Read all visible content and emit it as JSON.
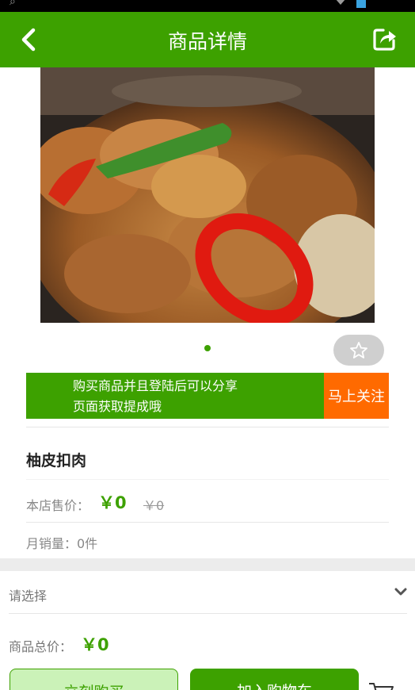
{
  "header": {
    "title": "商品详情"
  },
  "promo": {
    "line1": "购买商品并且登陆后可以分享",
    "line2": "页面获取提成哦",
    "follow_label": "马上关注"
  },
  "product": {
    "name": "柚皮扣肉",
    "price_label": "本店售价：",
    "price": "￥0",
    "original_price": "￥0",
    "monthly_sales": "月销量：0件"
  },
  "order": {
    "select_placeholder": "请选择",
    "total_label": "商品总价：",
    "total": "￥0",
    "buy_now_label": "立刻购买",
    "add_to_cart_label": "加入购物车"
  },
  "colors": {
    "accent": "#3da100",
    "follow": "#ff6a00"
  },
  "icons": [
    "back-arrow-icon",
    "share-icon",
    "star-icon",
    "chevron-down-icon",
    "cart-icon"
  ]
}
